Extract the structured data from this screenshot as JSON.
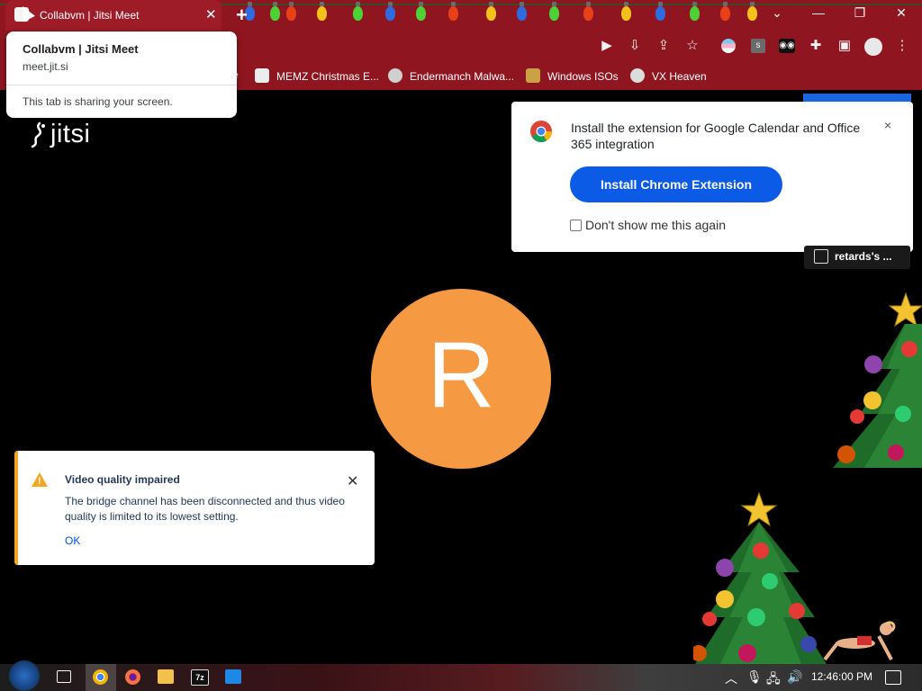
{
  "browser": {
    "tab_title": "Collabvm | Jitsi Meet",
    "new_tab_icon": "plus-icon",
    "window_controls": [
      "minimize-icon",
      "restore-icon",
      "close-icon"
    ]
  },
  "hover_card": {
    "title": "Collabvm | Jitsi Meet",
    "url": "meet.jit.si",
    "note": "This tab is sharing your screen."
  },
  "bookmarks": [
    {
      "label": "MEMZ Christmas E...",
      "icon": "bookmark-favicon"
    },
    {
      "label": "Endermanch Malwa...",
      "icon": "bookmark-favicon"
    },
    {
      "label": "Windows ISOs",
      "icon": "bookmark-favicon"
    },
    {
      "label": "VX Heaven",
      "icon": "bookmark-favicon"
    }
  ],
  "bookmark_truncated_prefix": "e",
  "jitsi": {
    "logo_text": "jitsi",
    "avatar_letter": "R",
    "avatar_color": "#f59a42"
  },
  "extension_popup": {
    "message": "Install the extension for Google Calendar and Office 365 integration",
    "button_label": "Install Chrome Extension",
    "checkbox_label": "Don't show me this again",
    "close_label": "×",
    "button_color": "#0c5be6"
  },
  "share_pill": {
    "label": "retards's ..."
  },
  "notification": {
    "title": "Video quality impaired",
    "body": "The bridge channel has been disconnected and thus video quality is limited to its lowest setting.",
    "ok_label": "OK",
    "close_label": "✕",
    "accent_color": "#f5a623"
  },
  "taskbar": {
    "clock": "12:46:00 PM"
  }
}
